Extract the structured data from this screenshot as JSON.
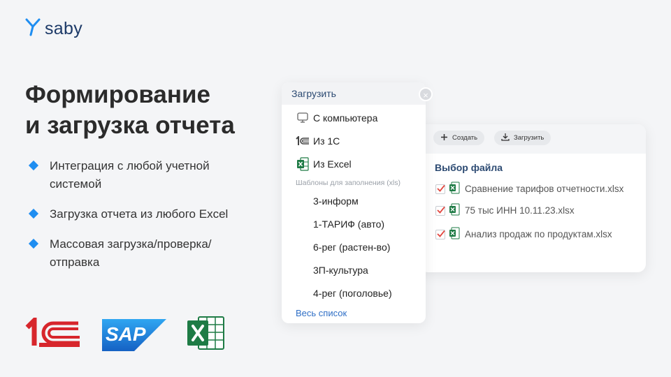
{
  "brand": {
    "name": "saby"
  },
  "title": [
    "Формирование",
    "и загрузка отчета"
  ],
  "bullets": [
    "Интеграция с любой учетной системой",
    "Загрузка отчета из любого Excel",
    "Массовая загрузка/проверка/ отправка"
  ],
  "logos": {
    "sap": "SAP"
  },
  "menu": {
    "title": "Загрузить",
    "close": "×",
    "items": [
      "С компьютера",
      "Из 1С",
      "Из Excel"
    ],
    "templates_label": "Шаблоны для заполнения (xls)",
    "templates": [
      "3-информ",
      "1-ТАРИФ (авто)",
      "6-рег (растен-во)",
      "3П-культура",
      "4-рег (поголовье)"
    ],
    "all_link": "Весь список"
  },
  "files": {
    "toolbar": {
      "create": "Создать",
      "upload": "Загрузить"
    },
    "title": "Выбор файла",
    "list": [
      "Сравнение тарифов отчетности.xlsx",
      "75 тыс ИНН 10.11.23.xlsx",
      "Анализ продаж по продуктам.xlsx"
    ]
  },
  "colors": {
    "accent": "#1f8ef1",
    "brand_dark": "#1d3a68",
    "link": "#2f6fc6",
    "excel_green": "#1e7b45",
    "onec_red": "#d7262c",
    "sap_blue": "#1a73d1",
    "check_red": "#e2463f"
  },
  "icons": [
    "saby-logo-icon",
    "close-icon",
    "monitor-icon",
    "onec-icon",
    "excel-icon",
    "plus-icon",
    "download-icon",
    "checkmark-icon"
  ]
}
